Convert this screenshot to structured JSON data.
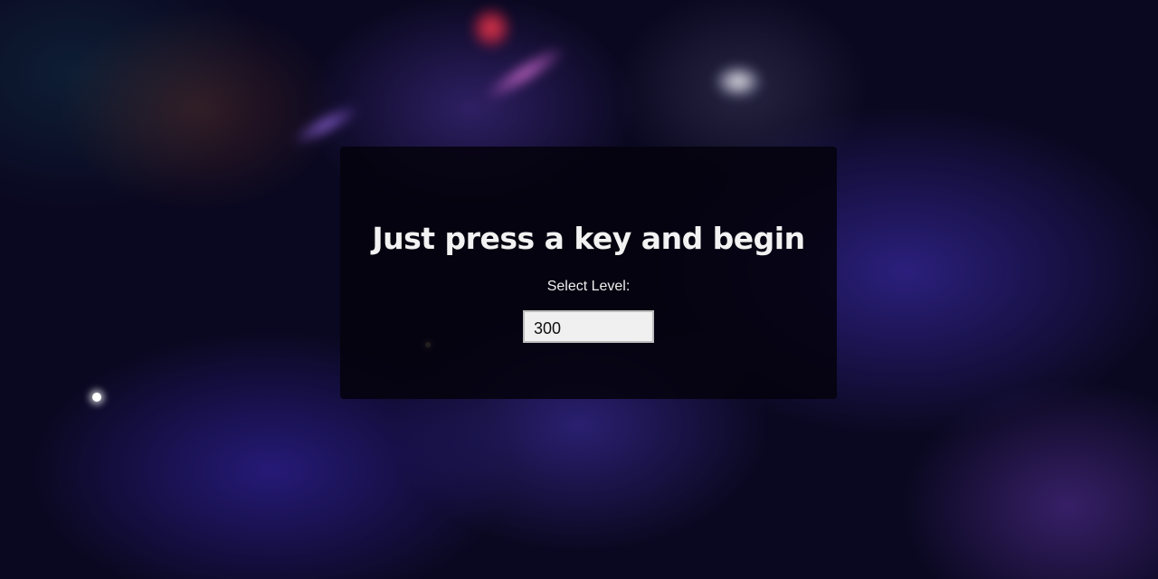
{
  "dialog": {
    "title": "Just press a key and begin",
    "level_label": "Select Level:",
    "level_value": "300"
  }
}
